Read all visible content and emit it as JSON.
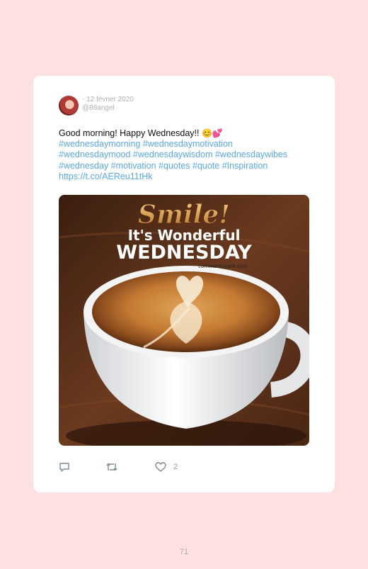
{
  "tweet": {
    "date": "· 12 février 2020",
    "handle": "@88angel",
    "text_line1": "Good morning! Happy Wednesday!! ",
    "emojis": "😊💕",
    "hashtags_line1": "#wednesdaymorning #wednesdaymotivation",
    "hashtags_line2": "#wednesdaymood #wednesdaywisdom #wednesdaywibes",
    "hashtags_line3": "#wednesday #motivation #quotes #quote #Inspiration",
    "link": "https://t.co/AEReu11tHk"
  },
  "media": {
    "headline": "Smile!",
    "subline": "It's Wonderful",
    "day": "WEDNESDAY",
    "watermark": "commentsyard.com"
  },
  "actions": {
    "reply_icon": "reply-icon",
    "retweet_icon": "retweet-icon",
    "like_icon": "heart-icon",
    "like_count": "2"
  },
  "footer": {
    "page_number": "71"
  },
  "colors": {
    "background": "#fde1e1",
    "card": "#ffffff",
    "hashtag": "#5aa8e6",
    "meta": "#aab2b8"
  }
}
